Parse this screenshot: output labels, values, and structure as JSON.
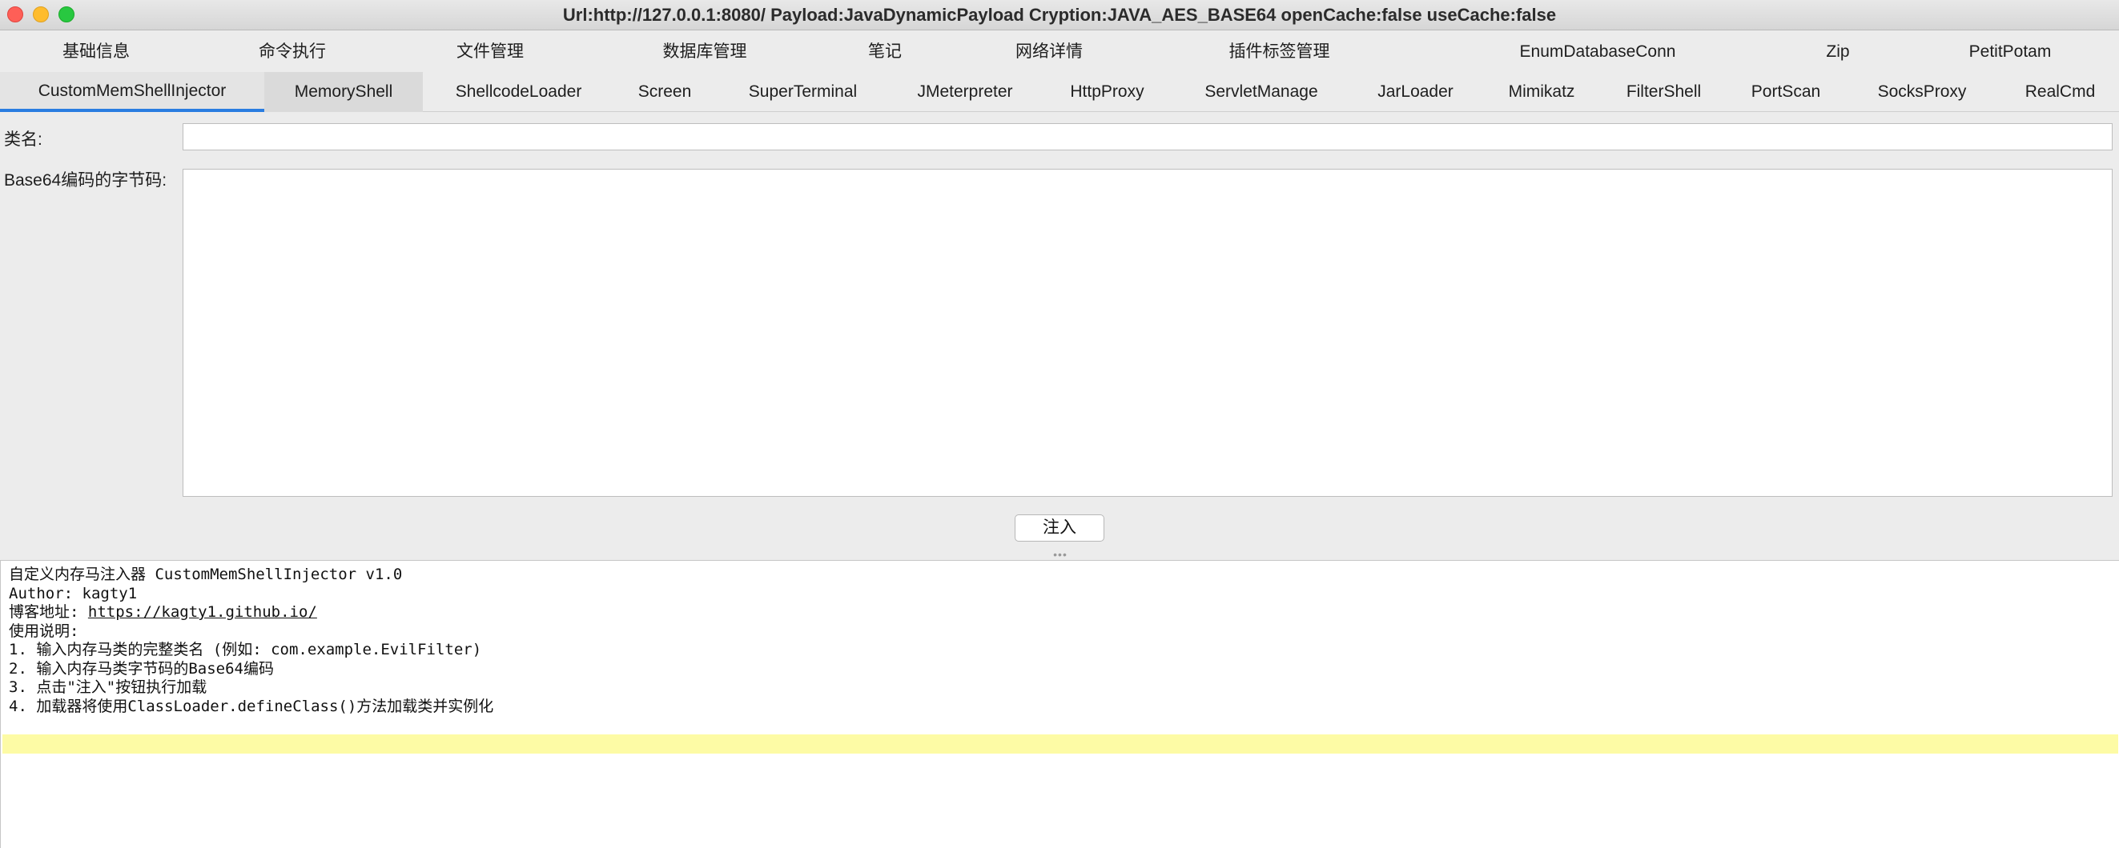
{
  "window": {
    "title": "Url:http://127.0.0.1:8080/ Payload:JavaDynamicPayload Cryption:JAVA_AES_BASE64 openCache:false useCache:false"
  },
  "tabs_row1": [
    {
      "label": "基础信息"
    },
    {
      "label": "命令执行"
    },
    {
      "label": "文件管理"
    },
    {
      "label": "数据库管理"
    },
    {
      "label": "笔记"
    },
    {
      "label": "网络详情"
    },
    {
      "label": "插件标签管理"
    },
    {
      "label": "EnumDatabaseConn"
    },
    {
      "label": "Zip"
    },
    {
      "label": "PetitPotam"
    }
  ],
  "tabs_row2": [
    {
      "label": "CustomMemShellInjector",
      "active": true
    },
    {
      "label": "MemoryShell"
    },
    {
      "label": "ShellcodeLoader"
    },
    {
      "label": "Screen"
    },
    {
      "label": "SuperTerminal"
    },
    {
      "label": "JMeterpreter"
    },
    {
      "label": "HttpProxy"
    },
    {
      "label": "ServletManage"
    },
    {
      "label": "JarLoader"
    },
    {
      "label": "Mimikatz"
    },
    {
      "label": "FilterShell"
    },
    {
      "label": "PortScan"
    },
    {
      "label": "SocksProxy"
    },
    {
      "label": "RealCmd"
    }
  ],
  "form": {
    "class_name_label": "类名:",
    "class_name_value": "",
    "bytecode_label": "Base64编码的字节码:",
    "bytecode_value": "",
    "inject_button": "注入"
  },
  "output": {
    "lines": [
      "自定义内存马注入器 CustomMemShellInjector v1.0",
      "Author: kagty1",
      "博客地址: ",
      "使用说明:",
      "1. 输入内存马类的完整类名 (例如: com.example.EvilFilter)",
      "2. 输入内存马类字节码的Base64编码",
      "3. 点击\"注入\"按钮执行加载",
      "4. 加载器将使用ClassLoader.defineClass()方法加载类并实例化"
    ],
    "blog_url": "https://kagty1.github.io/"
  },
  "colors": {
    "active_tab_underline": "#2a7de1",
    "highlight_line": "#fdfba5",
    "close": "#fe5f57",
    "minimize": "#febc2e",
    "maximize": "#28c840"
  }
}
